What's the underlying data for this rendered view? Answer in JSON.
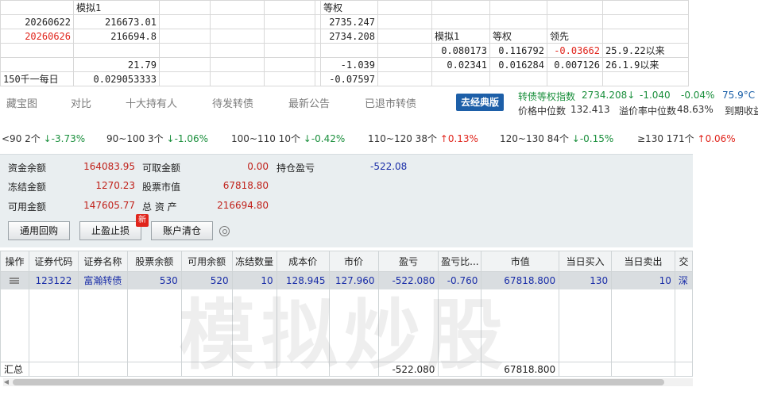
{
  "sheet": {
    "rows": [
      [
        "",
        "模拟1",
        "",
        "",
        "",
        "",
        "等权",
        "",
        "",
        "",
        "",
        ""
      ],
      [
        "20260622",
        "216673.01",
        "",
        "",
        "",
        "",
        "2735.247",
        "",
        "",
        "",
        "",
        ""
      ],
      [
        "20260626",
        "216694.8",
        "",
        "",
        "",
        "",
        "2734.208",
        "",
        "模拟1",
        "等权",
        "领先",
        ""
      ],
      [
        "",
        "",
        "",
        "",
        "",
        "",
        "",
        "",
        "0.080173",
        "0.116792",
        "-0.03662",
        "25.9.22以来"
      ],
      [
        "",
        "21.79",
        "",
        "",
        "",
        "",
        "-1.039",
        "",
        "0.02341",
        "0.016284",
        "0.007126",
        "26.1.9以来"
      ],
      [
        "150千一每日",
        "0.029053333",
        "",
        "",
        "",
        "",
        "-0.07597",
        "",
        "",
        "",
        "",
        ""
      ]
    ]
  },
  "nav": {
    "tabs": [
      "藏宝图",
      "对比",
      "十大持有人",
      "待发转债",
      "最新公告",
      "已退市转债"
    ],
    "classic_button": "去经典版"
  },
  "index": {
    "name": "转债等权指数",
    "value": "2734.208↓",
    "change": "-1.040",
    "pct": "-0.04%",
    "temp": "75.9°C",
    "median_price_label": "价格中位数",
    "median_price": "132.413",
    "premium_label": "溢价率中位数",
    "premium": "48.63%",
    "maturity_label": "到期收益"
  },
  "ranges": [
    {
      "label": "<90 2个",
      "change": "↓-3.73%",
      "dir": "down"
    },
    {
      "label": "90~100 3个",
      "change": "↓-1.06%",
      "dir": "down"
    },
    {
      "label": "100~110 10个",
      "change": "↓-0.42%",
      "dir": "down"
    },
    {
      "label": "110~120 38个",
      "change": "↑0.13%",
      "dir": "up"
    },
    {
      "label": "120~130 84个",
      "change": "↓-0.15%",
      "dir": "down"
    },
    {
      "label": "≥130 171个",
      "change": "↑0.06%",
      "dir": "up"
    }
  ],
  "account": {
    "cash_label": "资金余额",
    "cash": "164083.95",
    "withdrawable_label": "可取金额",
    "withdrawable": "0.00",
    "pnl_label": "持仓盈亏",
    "pnl": "-522.08",
    "frozen_label": "冻结金额",
    "frozen": "1270.23",
    "market_value_label": "股票市值",
    "market_value": "67818.80",
    "available_label": "可用金额",
    "available": "147605.77",
    "total_label": "总 资 产",
    "total": "216694.80",
    "buttons": {
      "repo": "通用回购",
      "stop": "止盈止损",
      "clear": "账户清仓"
    },
    "new_badge": "新"
  },
  "grid": {
    "headers": [
      "操作",
      "证券代码",
      "证券名称",
      "股票余额",
      "可用余额",
      "冻结数量",
      "成本价",
      "市价",
      "盈亏",
      "盈亏比...",
      "市值",
      "当日买入",
      "当日卖出",
      "交"
    ],
    "rows": [
      [
        "",
        "123122",
        "富瀚转债",
        "530",
        "520",
        "10",
        "128.945",
        "127.960",
        "-522.080",
        "-0.760",
        "67818.800",
        "130",
        "10",
        "深"
      ]
    ],
    "summary": {
      "label": "汇总",
      "pnl": "-522.080",
      "market_value": "67818.800"
    },
    "watermark": "模拟炒股"
  }
}
